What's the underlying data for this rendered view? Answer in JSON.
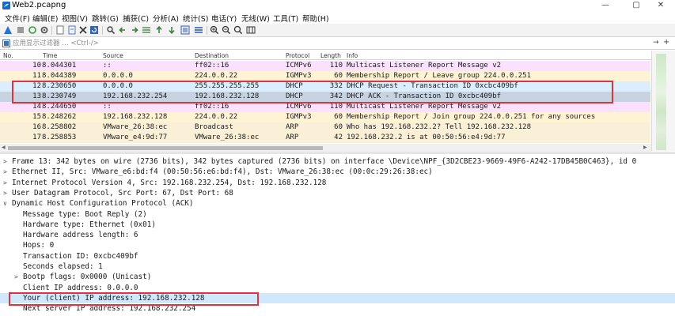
{
  "window": {
    "title": "Web2.pcapng",
    "minimize": "—",
    "maximize": "▢",
    "close": "✕"
  },
  "menu": [
    "文件(F)",
    "编辑(E)",
    "视图(V)",
    "跳转(G)",
    "捕获(C)",
    "分析(A)",
    "统计(S)",
    "电话(Y)",
    "无线(W)",
    "工具(T)",
    "帮助(H)"
  ],
  "filter": {
    "placeholder": "应用显示过滤器 … <Ctrl-/>",
    "arrow": "→",
    "plus": "+"
  },
  "columns": {
    "no": "No.",
    "time": "Time",
    "source": "Source",
    "destination": "Destination",
    "protocol": "Protocol",
    "length": "Length",
    "info": "Info"
  },
  "packets": [
    {
      "no": "10",
      "time": "8.044301",
      "source": "::",
      "destination": "ff02::16",
      "protocol": "ICMPv6",
      "length": "110",
      "info": "Multicast Listener Report Message v2",
      "kind": "icmp"
    },
    {
      "no": "11",
      "time": "8.044389",
      "source": "0.0.0.0",
      "destination": "224.0.0.22",
      "protocol": "IGMPv3",
      "length": "60",
      "info": "Membership Report / Leave group 224.0.0.251",
      "kind": "igmp"
    },
    {
      "no": "12",
      "time": "8.230650",
      "source": "0.0.0.0",
      "destination": "255.255.255.255",
      "protocol": "DHCP",
      "length": "332",
      "info": "DHCP Request  - Transaction ID 0xcbc409bf",
      "kind": "udp"
    },
    {
      "no": "13",
      "time": "8.230749",
      "source": "192.168.232.254",
      "destination": "192.168.232.128",
      "protocol": "DHCP",
      "length": "342",
      "info": "DHCP ACK      - Transaction ID 0xcbc409bf",
      "kind": "sel"
    },
    {
      "no": "14",
      "time": "8.244650",
      "source": "::",
      "destination": "ff02::16",
      "protocol": "ICMPv6",
      "length": "110",
      "info": "Multicast Listener Report Message v2",
      "kind": "icmp"
    },
    {
      "no": "15",
      "time": "8.248262",
      "source": "192.168.232.128",
      "destination": "224.0.0.22",
      "protocol": "IGMPv3",
      "length": "60",
      "info": "Membership Report / Join group 224.0.0.251 for any sources",
      "kind": "igmp"
    },
    {
      "no": "16",
      "time": "8.258802",
      "source": "VMware_26:38:ec",
      "destination": "Broadcast",
      "protocol": "ARP",
      "length": "60",
      "info": "Who has 192.168.232.2? Tell 192.168.232.128",
      "kind": "arp"
    },
    {
      "no": "17",
      "time": "8.258853",
      "source": "VMware_e4:9d:77",
      "destination": "VMware_26:38:ec",
      "protocol": "ARP",
      "length": "42",
      "info": "192.168.232.2 is at 00:50:56:e4:9d:77",
      "kind": "arp"
    }
  ],
  "details": [
    {
      "arrow": ">",
      "level": 0,
      "text": "Frame 13: 342 bytes on wire (2736 bits), 342 bytes captured (2736 bits) on interface \\Device\\NPF_{3D2CBE23-9669-49F6-A242-17DB45B0C463}, id 0"
    },
    {
      "arrow": ">",
      "level": 0,
      "text": "Ethernet II, Src: VMware_e6:bd:f4 (00:50:56:e6:bd:f4), Dst: VMware_26:38:ec (00:0c:29:26:38:ec)"
    },
    {
      "arrow": ">",
      "level": 0,
      "text": "Internet Protocol Version 4, Src: 192.168.232.254, Dst: 192.168.232.128"
    },
    {
      "arrow": ">",
      "level": 0,
      "text": "User Datagram Protocol, Src Port: 67, Dst Port: 68"
    },
    {
      "arrow": "∨",
      "level": 0,
      "text": "Dynamic Host Configuration Protocol (ACK)"
    },
    {
      "arrow": "",
      "level": 1,
      "text": "Message type: Boot Reply (2)"
    },
    {
      "arrow": "",
      "level": 1,
      "text": "Hardware type: Ethernet (0x01)"
    },
    {
      "arrow": "",
      "level": 1,
      "text": "Hardware address length: 6"
    },
    {
      "arrow": "",
      "level": 1,
      "text": "Hops: 0"
    },
    {
      "arrow": "",
      "level": 1,
      "text": "Transaction ID: 0xcbc409bf"
    },
    {
      "arrow": "",
      "level": 1,
      "text": "Seconds elapsed: 1"
    },
    {
      "arrow": ">",
      "level": 1,
      "text": "Bootp flags: 0x0000 (Unicast)"
    },
    {
      "arrow": "",
      "level": 1,
      "text": "Client IP address: 0.0.0.0"
    },
    {
      "arrow": "",
      "level": 1,
      "text": "Your (client) IP address: 192.168.232.128",
      "selected": true
    },
    {
      "arrow": "",
      "level": 1,
      "text": "Next server IP address: 192.168.232.254"
    }
  ],
  "toolbar_icons": [
    "shark-fin-start-icon",
    "stop-icon",
    "restart-icon",
    "options-gear-icon",
    "open-file-icon",
    "save-file-icon",
    "close-file-icon",
    "reload-icon",
    "find-packet-icon",
    "go-back-icon",
    "go-forward-icon",
    "go-to-packet-icon",
    "go-first-icon",
    "go-last-icon",
    "autoscroll-icon",
    "colorize-icon",
    "zoom-in-icon",
    "zoom-out-icon",
    "zoom-normal-icon",
    "resize-columns-icon"
  ],
  "colors": {
    "icmp": "#fce0ff",
    "igmp": "#fff3d6",
    "udp": "#daeeff",
    "arp": "#faf0d7",
    "selected": "#c7d3e0",
    "highlight_box": "#e0333c"
  }
}
